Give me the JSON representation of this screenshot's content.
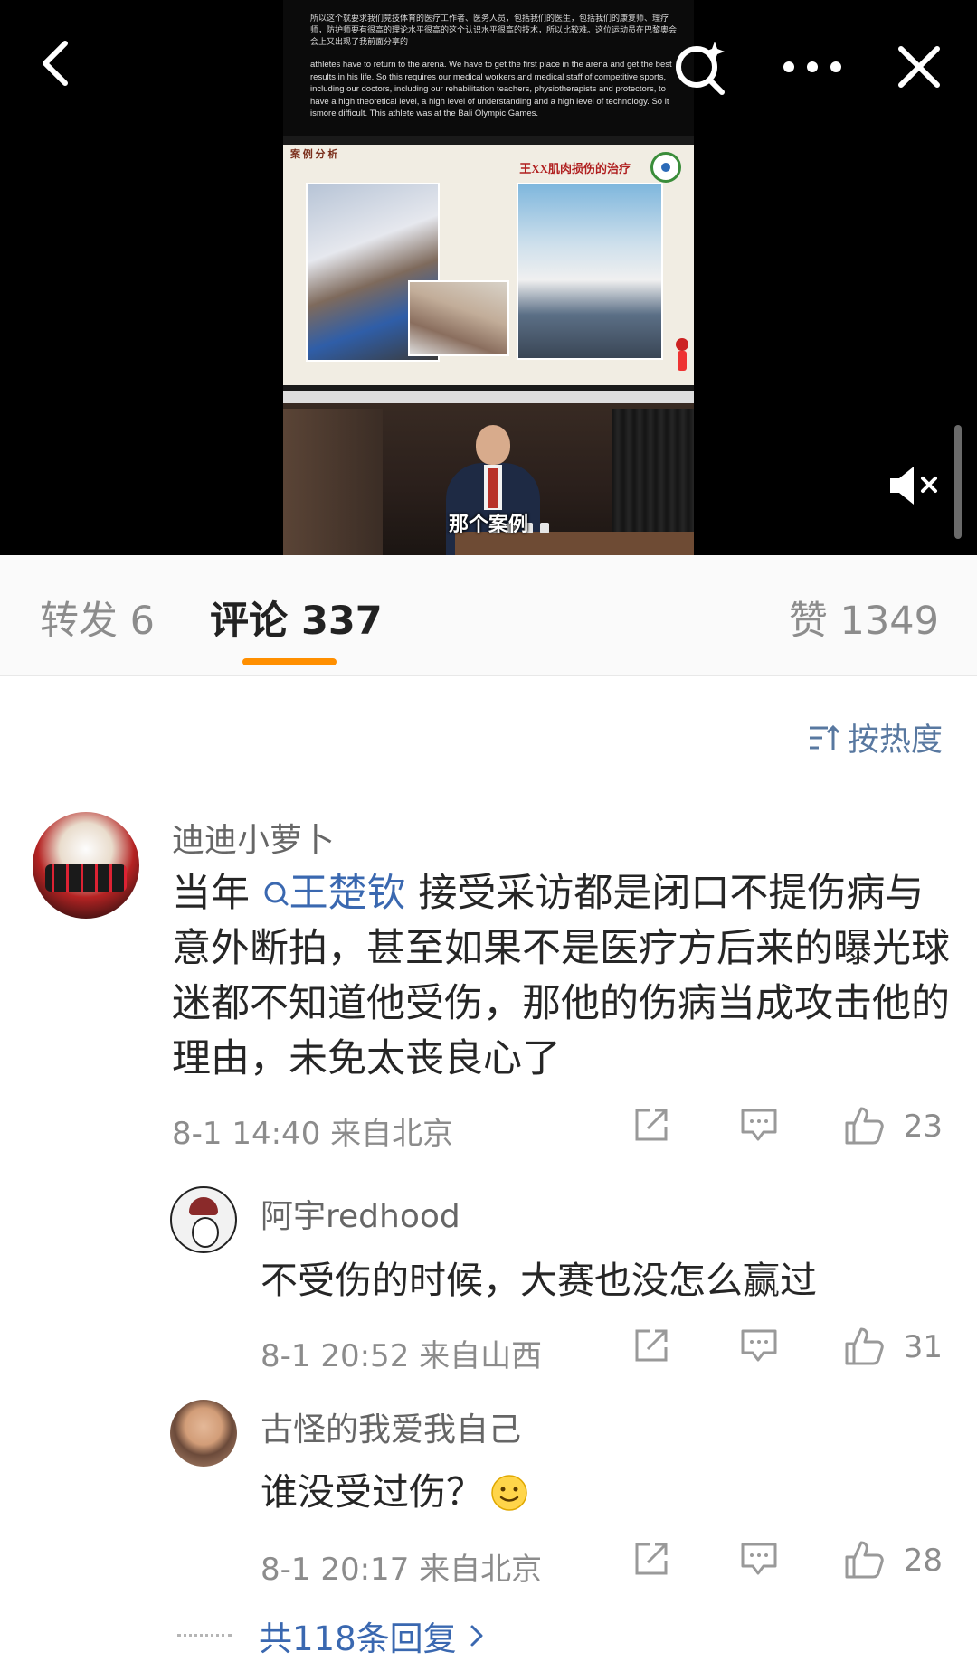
{
  "video": {
    "slide_cn_text": "所以这个就要求我们竞技体育的医疗工作者、医务人员，包括我们的医生，包括我们的康复师、理疗师，防护师要有很高的理论水平很高的这个认识水平很高的技术，所以比较难。这位运动员在巴黎奥会会上又出现了我前面分享的",
    "slide_en_text": "athletes have to return to the arena. We have to get the first place in the arena and get the best results in his life. So this requires our medical workers and medical staff of competitive sports, including our doctors, including our rehabilitation teachers, physiotherapists and protectors, to have a high theoretical level, a high level of understanding and a high level of technology. So it ismore difficult. This athlete was at the Bali Olympic Games.",
    "slide_case_label": "案 例 分 析",
    "slide_case_title": "王XX肌肉损伤的治疗",
    "subtitle": "那个案例",
    "icons": [
      "back-icon",
      "search-sparkle-icon",
      "more-icon",
      "close-icon",
      "mute-icon"
    ]
  },
  "tabs": {
    "repost": "转发 6",
    "comments": "评论 337",
    "likes": "赞 1349",
    "accent_color": "#ff8f00"
  },
  "sort": {
    "label": "按热度"
  },
  "comment": {
    "author": "迪迪小萝卜",
    "text_before": "当年",
    "mention": "王楚钦",
    "text_after": " 接受采访都是闭口不提伤病与意外断拍，甚至如果不是医疗方后来的曝光球迷都不知道他受伤，那他的伤病当成攻击他的理由，未免太丧良心了",
    "meta": "8-1 14:40  来自北京",
    "likes": "23"
  },
  "replies": [
    {
      "author": "阿宇redhood",
      "text": "不受伤的时候，大赛也没怎么赢过",
      "meta": "8-1 20:52  来自山西",
      "likes": "31"
    },
    {
      "author": "古怪的我爱我自己",
      "text": "谁没受过伤？",
      "meta": "8-1 20:17  来自北京",
      "likes": "28"
    }
  ],
  "more_replies": {
    "label": "共118条回复"
  },
  "colors": {
    "link": "#3a68b0",
    "secondary_text": "#8c8c8c"
  }
}
